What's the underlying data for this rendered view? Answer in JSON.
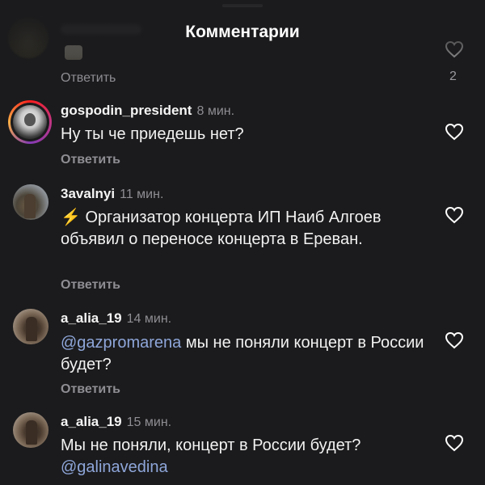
{
  "sheet": {
    "title": "Комментарии"
  },
  "faded_comment": {
    "reply_label": "Ответить",
    "like_count": "2"
  },
  "comments": [
    {
      "username": "gospodin_president",
      "time": "8 мин.",
      "text": "Ну ты че приедешь нет?",
      "reply_label": "Ответить",
      "avatar": "story-ring-avatar"
    },
    {
      "username": "3avalnyi",
      "time": "11 мин.",
      "emoji": "⚡",
      "text": "Организатор концерта ИП Наиб Алгоев объявил о переносе концерта в Ереван.",
      "reply_label": "Ответить",
      "avatar": "photo-avatar"
    },
    {
      "username": "a_alia_19",
      "time": "14 мин.",
      "mention": "@gazpromarena",
      "text": "мы не поняли концерт в России будет?",
      "reply_label": "Ответить",
      "avatar": "photo-avatar"
    },
    {
      "username": "a_alia_19",
      "time": "15 мин.",
      "text": "Мы не поняли, концерт в России будет?",
      "mention": "@galinavedina",
      "avatar": "photo-avatar"
    }
  ],
  "icons": {
    "like": "heart-outline-icon"
  },
  "colors": {
    "background": "#1b1b1d",
    "mention": "#8ea6d9",
    "secondary_text": "#8e8e93"
  }
}
